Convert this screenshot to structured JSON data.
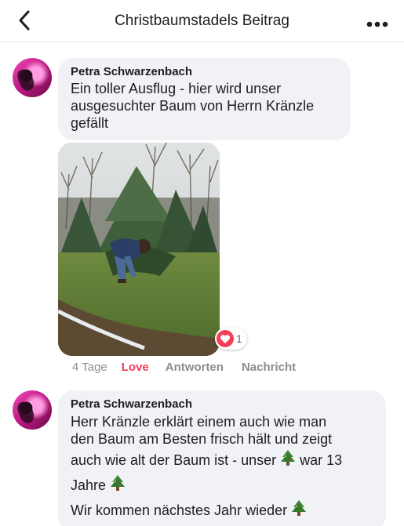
{
  "header": {
    "title": "Christbaumstadels Beitrag",
    "back_icon": "chevron-left-icon",
    "more_icon": "more-horizontal-icon"
  },
  "comments": [
    {
      "author": "Petra Schwarzenbach",
      "text": "Ein toller Ausflug - hier wird unser ausgesuchter Baum von Herrn Kränzle gefällt",
      "photo": "man cutting christmas tree in field",
      "reactions": {
        "icon": "heart-icon",
        "count": "1"
      },
      "actions": {
        "time": "4 Tage",
        "love": "Love",
        "reply": "Antworten",
        "message": "Nachricht"
      }
    },
    {
      "author": "Petra Schwarzenbach",
      "line1": "Herr Kränzle erklärt einem auch wie man",
      "line2": "den Baum am Besten frisch hält und zeigt",
      "line3a": "auch wie alt der Baum ist - unser",
      "line3b": "war 13",
      "line4": "Jahre",
      "line5": "Wir kommen nächstes Jahr wieder",
      "emoji": "christmas-tree-icon"
    }
  ],
  "colors": {
    "love": "#f33e58",
    "bubble": "#f0f2f5",
    "meta": "#8a8d91"
  }
}
